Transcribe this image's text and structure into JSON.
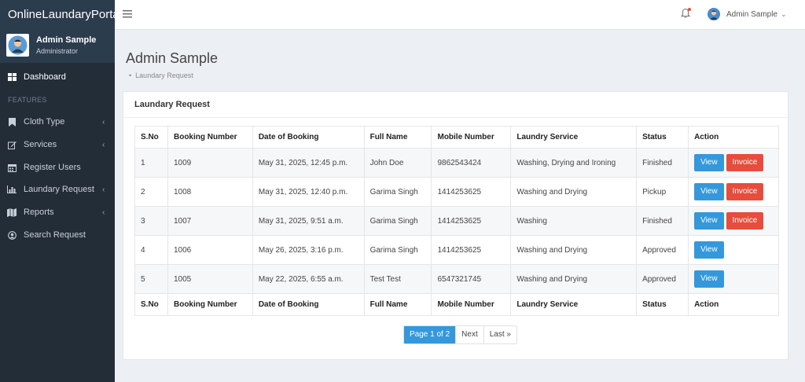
{
  "app": {
    "brand": "OnlineLaundaryPortal"
  },
  "sidebar": {
    "user_name": "Admin Sample",
    "user_role": "Administrator",
    "section_label": "FEATURES",
    "items": [
      {
        "label": "Dashboard",
        "icon": "dashboard-icon"
      },
      {
        "label": "Cloth Type",
        "icon": "bookmark-icon",
        "chevron": "‹"
      },
      {
        "label": "Services",
        "icon": "edit-icon",
        "chevron": "‹"
      },
      {
        "label": "Register Users",
        "icon": "calendar-icon"
      },
      {
        "label": "Laundary Request",
        "icon": "bar-chart-icon",
        "chevron": "‹"
      },
      {
        "label": "Reports",
        "icon": "map-icon",
        "chevron": "‹"
      },
      {
        "label": "Search Request",
        "icon": "user-circle-icon"
      }
    ]
  },
  "header": {
    "user_name": "Admin Sample",
    "caret": "⌄"
  },
  "page": {
    "title": "Admin Sample",
    "breadcrumb": "Laundary Request"
  },
  "card": {
    "title": "Laundary Request"
  },
  "table": {
    "columns": [
      "S.No",
      "Booking Number",
      "Date of Booking",
      "Full Name",
      "Mobile Number",
      "Laundry Service",
      "Status",
      "Action"
    ],
    "rows": [
      {
        "sno": "1",
        "booking": "1009",
        "date": "May 31, 2025, 12:45 p.m.",
        "name": "John Doe",
        "mobile": "9862543424",
        "service": "Washing, Drying and Ironing",
        "status": "Finished",
        "view": "View",
        "invoice": "Invoice"
      },
      {
        "sno": "2",
        "booking": "1008",
        "date": "May 31, 2025, 12:40 p.m.",
        "name": "Garima Singh",
        "mobile": "1414253625",
        "service": "Washing and Drying",
        "status": "Pickup",
        "view": "View",
        "invoice": "Invoice"
      },
      {
        "sno": "3",
        "booking": "1007",
        "date": "May 31, 2025, 9:51 a.m.",
        "name": "Garima Singh",
        "mobile": "1414253625",
        "service": "Washing",
        "status": "Finished",
        "view": "View",
        "invoice": "Invoice"
      },
      {
        "sno": "4",
        "booking": "1006",
        "date": "May 26, 2025, 3:16 p.m.",
        "name": "Garima Singh",
        "mobile": "1414253625",
        "service": "Washing and Drying",
        "status": "Approved",
        "view": "View"
      },
      {
        "sno": "5",
        "booking": "1005",
        "date": "May 22, 2025, 6:55 a.m.",
        "name": "Test Test",
        "mobile": "6547321745",
        "service": "Washing and Drying",
        "status": "Approved",
        "view": "View"
      }
    ]
  },
  "pagination": {
    "current": "Page 1 of 2",
    "next": "Next",
    "last": "Last »"
  },
  "colors": {
    "sidebar": "#232d37",
    "accent": "#3498db",
    "danger": "#e74c3c"
  }
}
